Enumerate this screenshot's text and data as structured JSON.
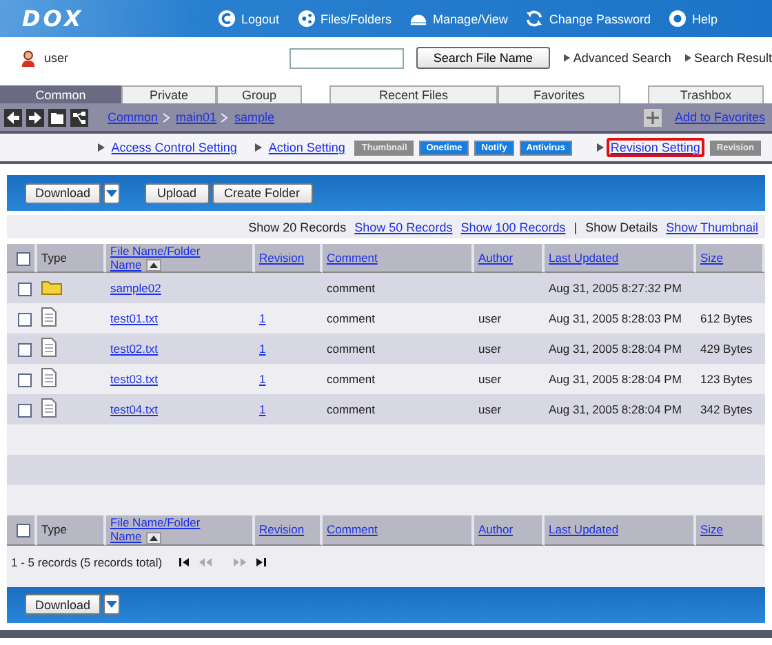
{
  "header": {
    "logo": "DOX",
    "nav": [
      {
        "kind": "logout",
        "label": "Logout"
      },
      {
        "kind": "files",
        "label": "Files/Folders"
      },
      {
        "kind": "manage",
        "label": "Manage/View"
      },
      {
        "kind": "password",
        "label": "Change Password"
      },
      {
        "kind": "help",
        "label": "Help"
      }
    ]
  },
  "user": {
    "name": "user"
  },
  "search": {
    "button": "Search File Name",
    "links": [
      "Advanced Search",
      "Search Result"
    ]
  },
  "tab_groups": [
    [
      {
        "label": "Common",
        "selected": true
      },
      {
        "label": "Private",
        "selected": false
      },
      {
        "label": "Group",
        "selected": false
      }
    ],
    [
      {
        "label": "Recent Files",
        "selected": false
      },
      {
        "label": "Favorites",
        "selected": false
      }
    ],
    [
      {
        "label": "Trashbox",
        "selected": false
      }
    ]
  ],
  "breadcrumb": [
    "Common",
    "main01",
    "sample"
  ],
  "favorites_link": "Add to Favorites",
  "actions": [
    {
      "kind": "link",
      "label": "Access Control Setting",
      "highlighted": false
    },
    {
      "kind": "link",
      "label": "Action Setting",
      "highlighted": false
    },
    {
      "kind": "badge",
      "label": "Thumbnail",
      "disabled": true
    },
    {
      "kind": "badge",
      "label": "Onetime",
      "disabled": false
    },
    {
      "kind": "badge",
      "label": "Notify",
      "disabled": false
    },
    {
      "kind": "badge",
      "label": "Antivirus",
      "disabled": false
    },
    {
      "kind": "link",
      "label": "Revision Setting",
      "highlighted": true
    },
    {
      "kind": "badge",
      "label": "Revision",
      "disabled": true
    }
  ],
  "toolbar": {
    "buttons": [
      {
        "label": "Download",
        "dropdown": true
      },
      {
        "label": "Upload",
        "dropdown": false
      },
      {
        "label": "Create Folder",
        "dropdown": false
      }
    ]
  },
  "view_options": [
    {
      "kind": "text",
      "label": "Show 20 Records"
    },
    {
      "kind": "link",
      "label": "Show 50 Records"
    },
    {
      "kind": "link",
      "label": "Show 100 Records"
    },
    {
      "kind": "separator",
      "label": "|"
    },
    {
      "kind": "text",
      "label": "Show Details"
    },
    {
      "kind": "link",
      "label": "Show Thumbnail"
    }
  ],
  "table": {
    "select_all_checked": false,
    "columns": [
      {
        "label": "Type",
        "link": false,
        "sorted": false
      },
      {
        "label": "File Name/Folder Name",
        "link": true,
        "sorted": true
      },
      {
        "label": "Revision",
        "link": true,
        "sorted": false
      },
      {
        "label": "Comment",
        "link": true,
        "sorted": false
      },
      {
        "label": "Author",
        "link": true,
        "sorted": false
      },
      {
        "label": "Last Updated",
        "link": true,
        "sorted": false
      },
      {
        "label": "Size",
        "link": true,
        "sorted": false
      }
    ],
    "rows": [
      {
        "kind": "folder",
        "checked": false,
        "name": "sample02",
        "comment": "comment",
        "updated": "Aug 31, 2005 8:27:32 PM"
      },
      {
        "kind": "file",
        "checked": false,
        "name": "test01.txt",
        "revision": "1",
        "comment": "comment",
        "author": "user",
        "updated": "Aug 31, 2005 8:28:03 PM",
        "size": "612 Bytes"
      },
      {
        "kind": "file",
        "checked": false,
        "name": "test02.txt",
        "revision": "1",
        "comment": "comment",
        "author": "user",
        "updated": "Aug 31, 2005 8:28:04 PM",
        "size": "429 Bytes"
      },
      {
        "kind": "file",
        "checked": false,
        "name": "test03.txt",
        "revision": "1",
        "comment": "comment",
        "author": "user",
        "updated": "Aug 31, 2005 8:28:04 PM",
        "size": "123 Bytes"
      },
      {
        "kind": "file",
        "checked": false,
        "name": "test04.txt",
        "revision": "1",
        "comment": "comment",
        "author": "user",
        "updated": "Aug 31, 2005 8:28:04 PM",
        "size": "342 Bytes"
      }
    ],
    "footer_select_all_checked": false,
    "footer_columns": [
      {
        "label": "Type",
        "link": false,
        "sorted": false
      },
      {
        "label": "File Name/Folder Name",
        "link": true,
        "sorted": true
      },
      {
        "label": "Revision",
        "link": true,
        "sorted": false
      },
      {
        "label": "Comment",
        "link": true,
        "sorted": false
      },
      {
        "label": "Author",
        "link": true,
        "sorted": false
      },
      {
        "label": "Last Updated",
        "link": true,
        "sorted": false
      },
      {
        "label": "Size",
        "link": true,
        "sorted": false
      }
    ]
  },
  "pager": {
    "summary": "1 - 5 records (5 records total)",
    "buttons": [
      {
        "kind": "first",
        "disabled": false
      },
      {
        "kind": "prev",
        "disabled": true
      },
      {
        "kind": "next",
        "disabled": true
      },
      {
        "kind": "last",
        "disabled": false
      }
    ]
  },
  "bottom_toolbar": {
    "buttons": [
      {
        "label": "Download",
        "dropdown": true
      }
    ]
  }
}
